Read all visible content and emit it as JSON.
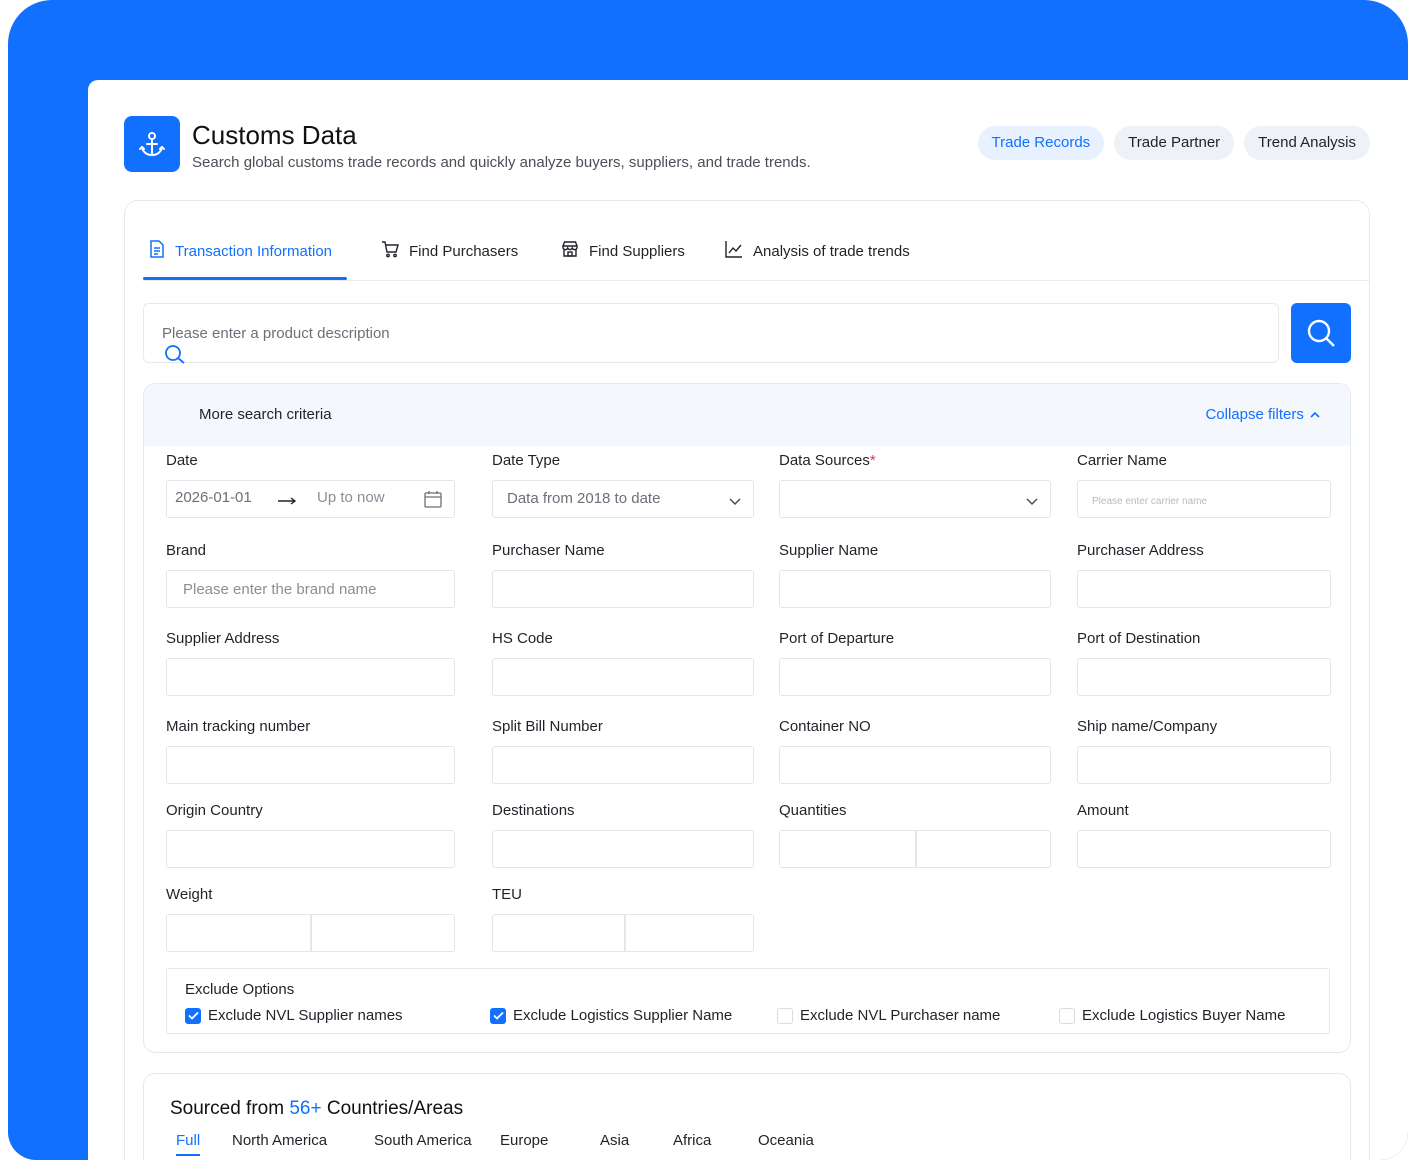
{
  "header": {
    "title": "Customs Data",
    "subtitle": "Search global customs trade records and quickly analyze buyers, suppliers, and trade trends.",
    "logo_icon": "anchor-icon",
    "nav": [
      {
        "label": "Trade Records",
        "active": true
      },
      {
        "label": "Trade Partner",
        "active": false
      },
      {
        "label": "Trend Analysis",
        "active": false
      }
    ]
  },
  "tabs": [
    {
      "label": "Transaction Information",
      "icon": "document-icon",
      "active": true
    },
    {
      "label": "Find Purchasers",
      "icon": "cart-icon",
      "active": false
    },
    {
      "label": "Find Suppliers",
      "icon": "store-icon",
      "active": false
    },
    {
      "label": "Analysis of trade trends",
      "icon": "line-chart-icon",
      "active": false
    }
  ],
  "search": {
    "placeholder": "Please enter a product description",
    "value": ""
  },
  "filters": {
    "more_criteria": "More search criteria",
    "collapse": "Collapse filters",
    "date_label": "Date",
    "date_start": "2026-01-01",
    "date_end": "Up to now",
    "date_type_label": "Date Type",
    "date_type_value": "Data from 2018 to date",
    "data_sources_label": "Data Sources",
    "data_sources_required": "*",
    "carrier_name_label": "Carrier Name",
    "carrier_name_placeholder": "Please enter carrier name",
    "brand_label": "Brand",
    "brand_placeholder": "Please enter the brand name",
    "purchaser_name_label": "Purchaser Name",
    "supplier_name_label": "Supplier Name",
    "purchaser_address_label": "Purchaser Address",
    "supplier_address_label": "Supplier Address",
    "hs_code_label": "HS Code",
    "port_departure_label": "Port of Departure",
    "port_destination_label": "Port of Destination",
    "main_tracking_label": "Main tracking number",
    "split_bill_label": "Split Bill Number",
    "container_label": "Container NO",
    "ship_name_label": "Ship name/Company",
    "origin_country_label": "Origin Country",
    "destinations_label": "Destinations",
    "quantities_label": "Quantities",
    "amount_label": "Amount",
    "weight_label": "Weight",
    "teu_label": "TEU"
  },
  "exclude": {
    "title": "Exclude Options",
    "options": [
      {
        "label": "Exclude NVL Supplier names",
        "checked": true
      },
      {
        "label": "Exclude Logistics Supplier Name",
        "checked": true
      },
      {
        "label": "Exclude NVL Purchaser name",
        "checked": false
      },
      {
        "label": "Exclude Logistics Buyer Name",
        "checked": false
      }
    ]
  },
  "sourced": {
    "prefix": "Sourced from",
    "count": "56+",
    "suffix": "Countries/Areas",
    "regions": [
      "Full",
      "North America",
      "South America",
      "Europe",
      "Asia",
      "Africa",
      "Oceania"
    ],
    "active_region": "Full"
  },
  "colors": {
    "accent": "#1270ff",
    "frame": "#1270ff",
    "required": "#e5363e"
  }
}
